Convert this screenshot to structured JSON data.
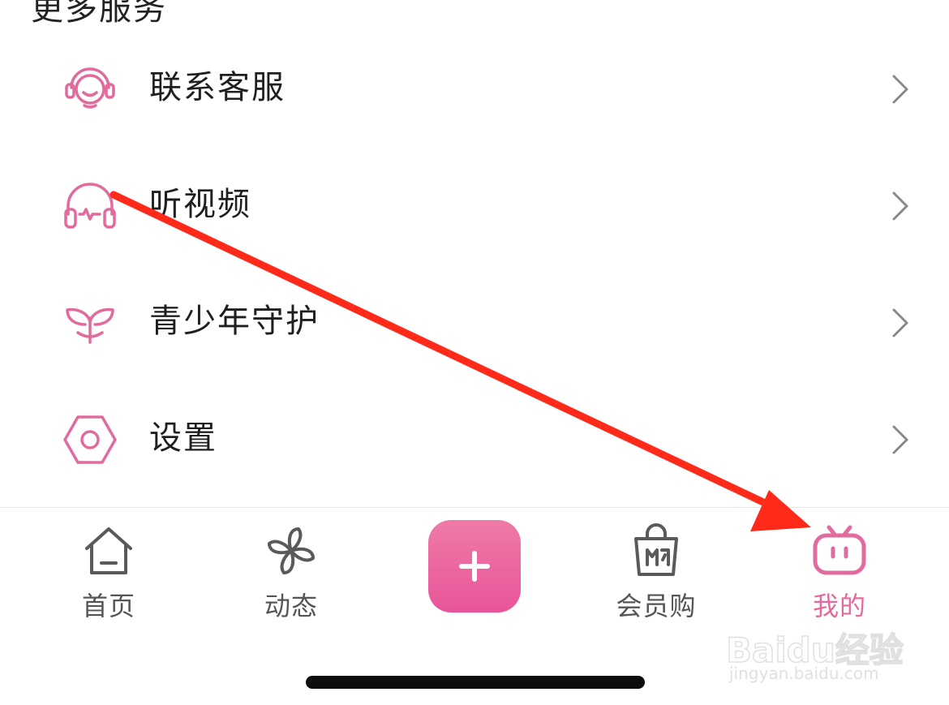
{
  "section_title": "更多服务",
  "menu": [
    {
      "label": "联系客服",
      "icon": "headset-icon"
    },
    {
      "label": "听视频",
      "icon": "headphones-icon"
    },
    {
      "label": "青少年守护",
      "icon": "sprout-icon"
    },
    {
      "label": "设置",
      "icon": "settings-hexagon-icon"
    }
  ],
  "tabbar": {
    "home": "首页",
    "dynamic": "动态",
    "publish_icon": "plus-icon",
    "vip_shop": "会员购",
    "mine": "我的",
    "active": "mine"
  },
  "watermark": {
    "brand": "Baidu经验",
    "url": "jingyan.baidu.com"
  },
  "colors": {
    "accent": "#e06b9c",
    "annotation_arrow": "#ff2a1a",
    "text": "#1f1f1f",
    "inactive_tab": "#555555"
  }
}
